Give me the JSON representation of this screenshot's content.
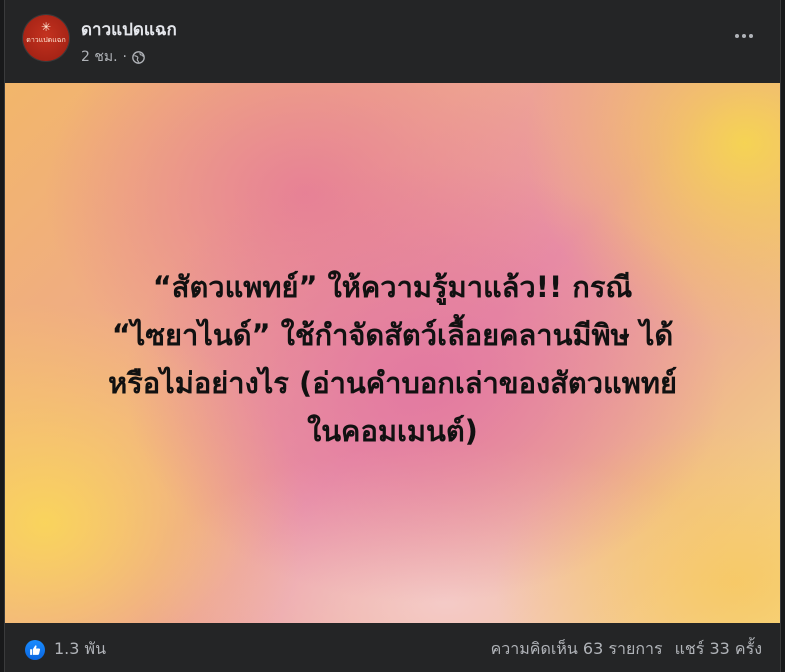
{
  "post": {
    "page_name": "ดาวแปดแฉก",
    "avatar_text": "ดาวแปดแฉก",
    "timestamp": "2 ชม.",
    "meta_separator": "·",
    "audience_icon": "globe-icon",
    "more_icon": "more-horizontal-icon"
  },
  "image": {
    "headline_lines": [
      "“สัตวแพทย์” ให้ความรู้มาแล้ว!! กรณี",
      "“ไซยาไนด์” ใช้กำจัดสัตว์เลื้อยคลานมีพิษ ได้",
      "หรือไม่อย่างไร (อ่านคำบอกเล่าของสัตวแพทย์",
      "ในคอมเมนต์)"
    ],
    "colors": {
      "pink": "#e991a6",
      "yellow": "#f6dc8c",
      "orange": "#f2b66a"
    }
  },
  "footer": {
    "reaction_icon": "like-icon",
    "reaction_count": "1.3 พัน",
    "comments": "ความคิดเห็น 63 รายการ",
    "shares": "แชร์ 33 ครั้ง"
  },
  "theme": {
    "background": "#242526",
    "text_primary": "#e4e6eb",
    "text_secondary": "#b0b3b8",
    "like_blue": "#1877f2"
  }
}
